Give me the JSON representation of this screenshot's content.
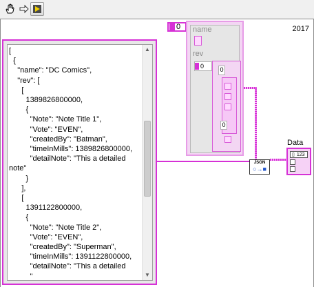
{
  "window": {
    "version": "2017"
  },
  "toolbar": {
    "icons": [
      "hand-icon",
      "arrow-icon",
      "run-icon"
    ]
  },
  "diagram": {
    "numeric_constant": "0",
    "cluster": {
      "field1_label": "name",
      "field2_label": "rev",
      "index_value": "0",
      "inner_index_value": "0",
      "inner_index_value2": "0"
    },
    "json_vi_label": "JSON",
    "indicator_label": "Data",
    "indicator_type": "123"
  },
  "string_control": {
    "text": "[\n  {\n    \"name\": \"DC Comics\",\n    \"rev\": [\n      [\n        1389826800000,\n        {\n          \"Note\": \"Note Title 1\",\n          \"Vote\": \"EVEN\",\n          \"createdBy\": \"Batman\",\n          \"timeInMills\": 1389826800000,\n          \"detailNote\": \"This a detailed\nnote\"\n        }\n      ],\n      [\n        1391122800000,\n        {\n          \"Note\": \"Note Title 2\",\n          \"Vote\": \"EVEN\",\n          \"createdBy\": \"Superman\",\n          \"timeInMills\": 1391122800000,\n          \"detailNote\": \"This a detailed\n          \""
  },
  "colors": {
    "string_wire": "#d631d6",
    "cluster_bg": "#f3d6f3"
  }
}
